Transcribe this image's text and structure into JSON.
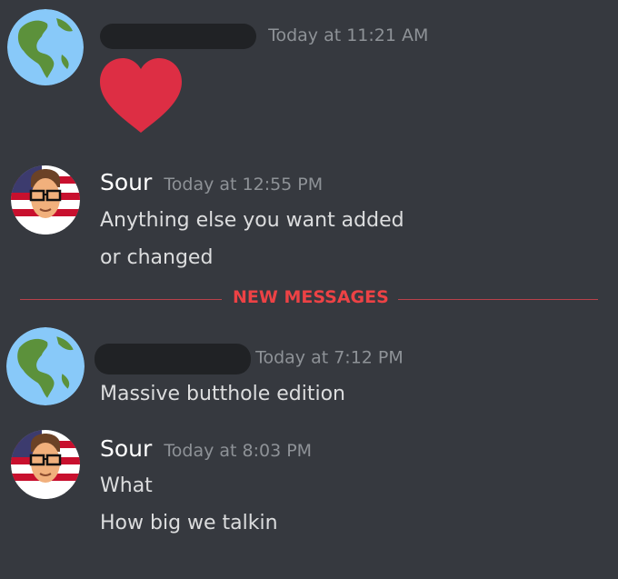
{
  "messages": [
    {
      "author": "",
      "author_redacted": true,
      "avatar": "globe-icon",
      "timestamp": "Today at 11:21 AM",
      "lines": [],
      "reaction": "heart-icon"
    },
    {
      "author": "Sour",
      "author_redacted": false,
      "avatar": "cartoon-man-icon",
      "timestamp": "Today at 12:55 PM",
      "lines": [
        "Anything else you want added",
        "or changed"
      ]
    },
    {
      "author": "",
      "author_redacted": true,
      "avatar": "globe-icon",
      "timestamp": "Today at 7:12 PM",
      "lines": [
        "Massive butthole edition"
      ]
    },
    {
      "author": "Sour",
      "author_redacted": false,
      "avatar": "cartoon-man-icon",
      "timestamp": "Today at 8:03 PM",
      "lines": [
        "What",
        "How big we talkin"
      ]
    }
  ],
  "divider": {
    "label": "NEW MESSAGES"
  },
  "colors": {
    "background": "#36393f",
    "text": "#dcddde",
    "username": "#ffffff",
    "timestamp": "#8e9297",
    "new_messages": "#ed4245",
    "heart": "#dd2e44",
    "redaction": "#202225"
  }
}
